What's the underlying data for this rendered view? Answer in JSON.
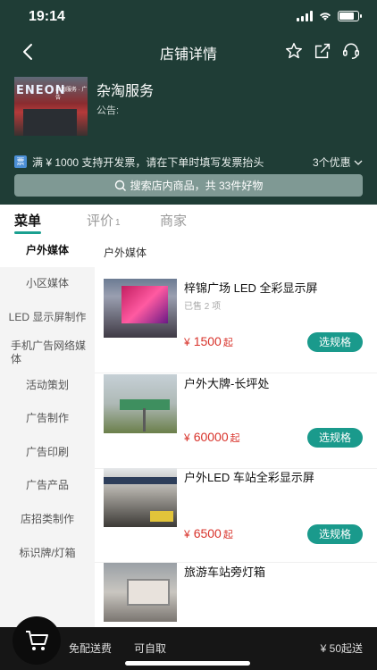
{
  "status_bar": {
    "time": "19:14"
  },
  "nav": {
    "title": "店铺详情"
  },
  "store": {
    "photo_sign": "ENEON",
    "photo_sign_small": "杂淘服务 · 广告",
    "name": "杂淘服务",
    "notice": "公告:"
  },
  "promo": {
    "badge": "票",
    "text": "满 ¥ 1000 支持开发票，请在下单时填写发票抬头",
    "more": "3个优惠"
  },
  "search": {
    "placeholder": "搜索店内商品，共 33件好物"
  },
  "tabs": [
    {
      "label": "菜单",
      "count": ""
    },
    {
      "label": "评价",
      "count": "1"
    },
    {
      "label": "商家",
      "count": ""
    }
  ],
  "categories": [
    "户外媒体",
    "小区媒体",
    "LED 显示屏制作",
    "手机广告网络媒体",
    "活动策划",
    "广告制作",
    "广告印刷",
    "广告产品",
    "店招类制作",
    "标识牌/灯箱"
  ],
  "section_title": "户外媒体",
  "products": [
    {
      "name": "梓锦广场 LED 全彩显示屏",
      "sold": "已售 2 项",
      "currency": "¥",
      "price": "1500",
      "suffix": "起",
      "button": "选规格"
    },
    {
      "name": "户外大牌-长坪处",
      "sold": "",
      "currency": "¥",
      "price": "60000",
      "suffix": "起",
      "button": "选规格"
    },
    {
      "name": "户外LED 车站全彩显示屏",
      "sold": "",
      "currency": "¥",
      "price": "6500",
      "suffix": "起",
      "button": "选规格"
    },
    {
      "name": "旅游车站旁灯箱",
      "sold": "",
      "currency": "¥",
      "price": "",
      "suffix": "",
      "button": ""
    }
  ],
  "bottom": {
    "free_delivery": "免配送费",
    "pickup": "可自取",
    "min_order": "¥ 50起送"
  },
  "colors": {
    "header_bg": "#1f3d36",
    "accent": "#1a9a8c",
    "price": "#d8332b",
    "bottom_bar": "#161616"
  },
  "icons": [
    "back-icon",
    "star-icon",
    "share-icon",
    "customer-service-icon",
    "search-icon",
    "chevron-down-icon",
    "cart-icon"
  ]
}
